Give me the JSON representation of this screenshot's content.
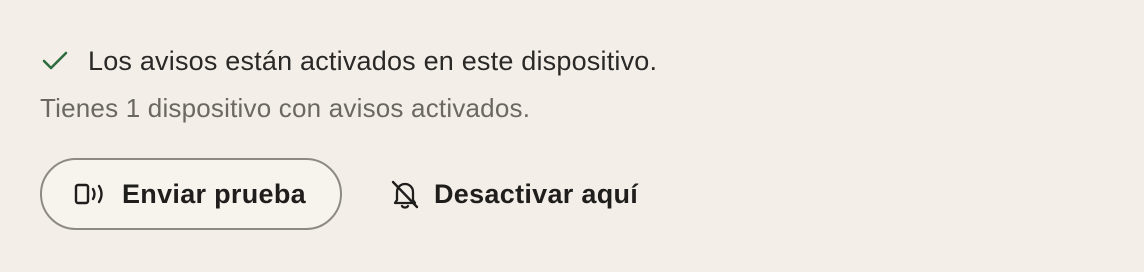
{
  "notifications": {
    "status_text": "Los avisos están activados en este dispositivo.",
    "device_count_text": "Tienes 1 dispositivo con avisos activados.",
    "status_icon": "check-icon",
    "status_icon_color": "#2f6b3f"
  },
  "actions": {
    "test_button": {
      "label": "Enviar prueba",
      "icon": "vibrate-icon"
    },
    "disable_button": {
      "label": "Desactivar aquí",
      "icon": "bell-off-icon"
    }
  },
  "colors": {
    "background": "#f3efe8",
    "primary_text": "#2a2927",
    "secondary_text": "#6b6862",
    "button_border": "#8d8a82"
  }
}
